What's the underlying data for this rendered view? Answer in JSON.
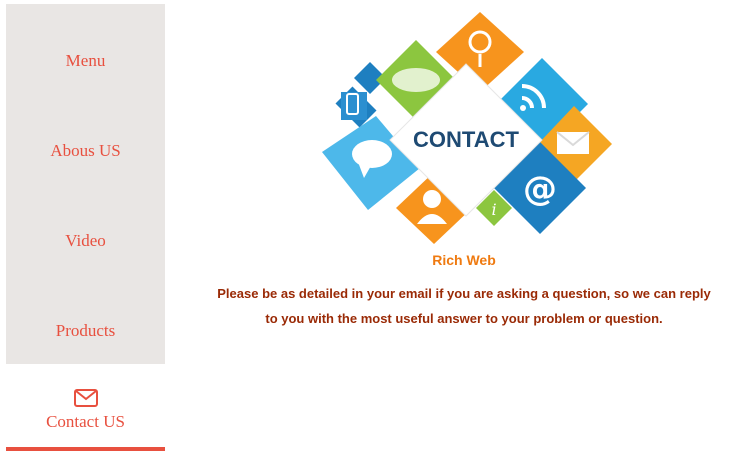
{
  "nav": {
    "items": [
      {
        "label": "Menu"
      },
      {
        "label": "Abous US"
      },
      {
        "label": "Video"
      },
      {
        "label": "Products"
      }
    ],
    "active": {
      "label": "Contact US",
      "icon": "envelope-icon"
    },
    "accent_color": "#e8503f"
  },
  "hero": {
    "label": "CONTACT",
    "icons": [
      "phone-icon",
      "world-map-icon",
      "location-pin-icon",
      "wifi-icon",
      "chat-bubble-icon",
      "mail-icon",
      "at-sign-icon",
      "users-icon",
      "info-icon"
    ]
  },
  "content": {
    "site_name": "Rich Web",
    "description_line1": "Please be as detailed in your email if you are asking a question, so we can reply",
    "description_line2": "to you with the most useful answer to your problem or question."
  }
}
